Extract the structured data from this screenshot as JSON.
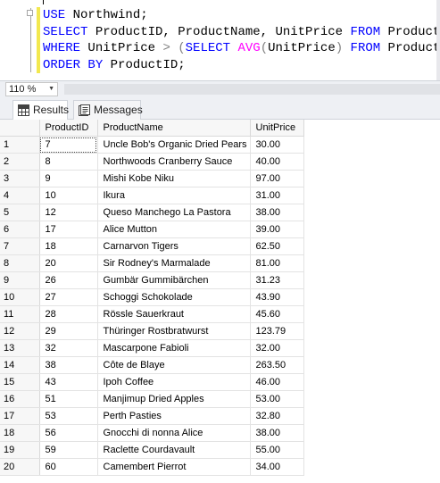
{
  "editor": {
    "line1": {
      "kw1": "USE",
      "rest": " Northwind;"
    },
    "line2": {
      "kw1": "SELECT",
      "rest": " ProductID, ProductName, UnitPrice ",
      "kw2": "FROM",
      "rest2": " Products"
    },
    "line3": {
      "kw1": "WHERE",
      "rest": " UnitPrice ",
      "op1": ">",
      "sp": " ",
      "op2": "(",
      "kw2": "SELECT",
      "sp2": " ",
      "fn": "AVG",
      "op3": "(",
      "mid": "UnitPrice",
      "op4": ")",
      "sp3": " ",
      "kw3": "FROM",
      "rest3": " Products",
      "op5": ")"
    },
    "line4": {
      "kw1": "ORDER",
      "sp": " ",
      "kw2": "BY",
      "rest": " ProductID;"
    }
  },
  "zoom": {
    "value": "110 %"
  },
  "tabs": [
    {
      "label": "Results",
      "icon": "grid-icon",
      "active": true
    },
    {
      "label": "Messages",
      "icon": "messages-icon",
      "active": false
    }
  ],
  "grid": {
    "columns": [
      "ProductID",
      "ProductName",
      "UnitPrice"
    ],
    "rows": [
      {
        "n": "1",
        "id": "7",
        "name": "Uncle Bob's Organic Dried Pears",
        "price": "30.00"
      },
      {
        "n": "2",
        "id": "8",
        "name": "Northwoods Cranberry Sauce",
        "price": "40.00"
      },
      {
        "n": "3",
        "id": "9",
        "name": "Mishi Kobe Niku",
        "price": "97.00"
      },
      {
        "n": "4",
        "id": "10",
        "name": "Ikura",
        "price": "31.00"
      },
      {
        "n": "5",
        "id": "12",
        "name": "Queso Manchego La Pastora",
        "price": "38.00"
      },
      {
        "n": "6",
        "id": "17",
        "name": "Alice Mutton",
        "price": "39.00"
      },
      {
        "n": "7",
        "id": "18",
        "name": "Carnarvon Tigers",
        "price": "62.50"
      },
      {
        "n": "8",
        "id": "20",
        "name": "Sir Rodney's Marmalade",
        "price": "81.00"
      },
      {
        "n": "9",
        "id": "26",
        "name": "Gumbär Gummibärchen",
        "price": "31.23"
      },
      {
        "n": "10",
        "id": "27",
        "name": "Schoggi Schokolade",
        "price": "43.90"
      },
      {
        "n": "11",
        "id": "28",
        "name": "Rössle Sauerkraut",
        "price": "45.60"
      },
      {
        "n": "12",
        "id": "29",
        "name": "Thüringer Rostbratwurst",
        "price": "123.79"
      },
      {
        "n": "13",
        "id": "32",
        "name": "Mascarpone Fabioli",
        "price": "32.00"
      },
      {
        "n": "14",
        "id": "38",
        "name": "Côte de Blaye",
        "price": "263.50"
      },
      {
        "n": "15",
        "id": "43",
        "name": "Ipoh Coffee",
        "price": "46.00"
      },
      {
        "n": "16",
        "id": "51",
        "name": "Manjimup Dried Apples",
        "price": "53.00"
      },
      {
        "n": "17",
        "id": "53",
        "name": "Perth Pasties",
        "price": "32.80"
      },
      {
        "n": "18",
        "id": "56",
        "name": "Gnocchi di nonna Alice",
        "price": "38.00"
      },
      {
        "n": "19",
        "id": "59",
        "name": "Raclette Courdavault",
        "price": "55.00"
      },
      {
        "n": "20",
        "id": "60",
        "name": "Camembert Pierrot",
        "price": "34.00"
      }
    ]
  },
  "colors": {
    "keyword": "#0000ff",
    "function": "#ff00ff",
    "operator": "#808080",
    "change_bar": "#f2e84f"
  }
}
